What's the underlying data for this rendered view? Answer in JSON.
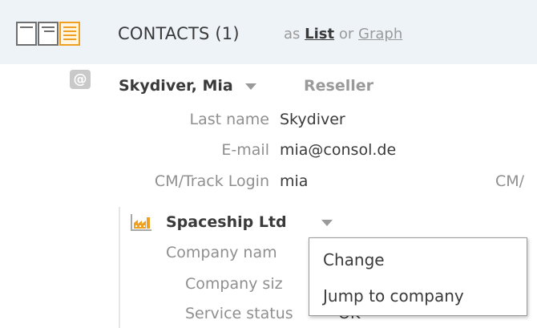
{
  "header": {
    "title": "CONTACTS (1)",
    "view_prefix": "as",
    "view_list": "List",
    "view_or": "or",
    "view_graph": "Graph"
  },
  "contact": {
    "at_symbol": "@",
    "name": "Skydiver, Mia",
    "role": "Reseller",
    "fields": [
      {
        "label": "Last name",
        "value": "Skydiver"
      },
      {
        "label": "E-mail",
        "value": "mia@consol.de"
      },
      {
        "label": "CM/Track Login",
        "value": "mia"
      }
    ],
    "cut_label": "CM/"
  },
  "company": {
    "name": "Spaceship Ltd",
    "fields": [
      {
        "label": "Company nam",
        "value": ""
      },
      {
        "label": "Company siz",
        "value": ""
      },
      {
        "label": "Service status",
        "value": "OK"
      }
    ]
  },
  "popup_menu": {
    "items": [
      "Change",
      "Jump to company"
    ]
  },
  "colors": {
    "header_bg": "#eef3f8",
    "active_view": "#f0a020",
    "muted_text": "#9a9a9a"
  },
  "icons": [
    "table-view-icon",
    "detail-view-icon",
    "list-view-icon",
    "at-icon",
    "caret-down-icon",
    "company-icon"
  ]
}
